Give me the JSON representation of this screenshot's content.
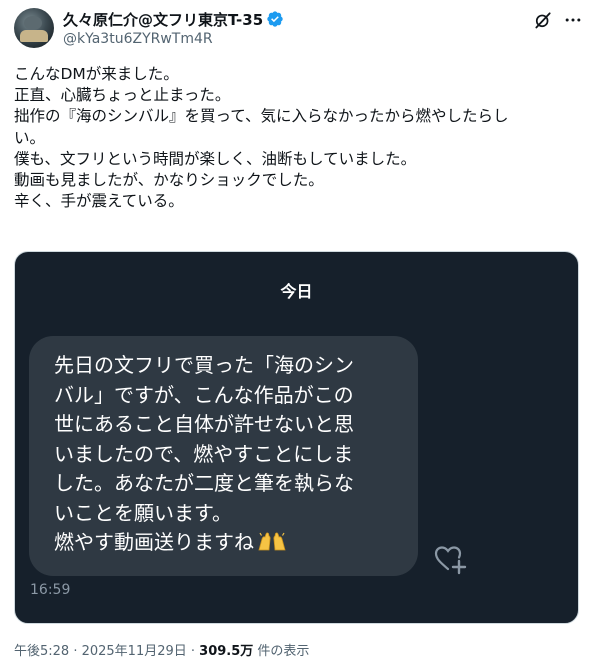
{
  "author": {
    "display_name": "久々原仁介@文フリ東京T-35",
    "handle": "@kYa3tu6ZYRwTm4R",
    "verified": true
  },
  "icons": {
    "verified": "verified-badge-icon",
    "grok": "grok-icon",
    "more": "more-options-icon",
    "react": "add-reaction-heart-icon",
    "emoji": "raising-hands-emoji"
  },
  "tweet": {
    "lines": [
      "こんなDMが来ました。",
      "正直、心臓ちょっと止まった。",
      "拙作の『海のシンバル』を買って、気に入らなかったから燃やしたらし",
      "い。",
      "僕も、文フリという時間が楽しく、油断もしていました。",
      "動画も見ましたが、かなりショックでした。",
      "辛く、手が震えている。"
    ]
  },
  "screenshot": {
    "day_label": "今日",
    "message_lines": [
      "先日の文フリで買った「海のシン",
      "バル」ですが、こんな作品がこの",
      "世にあること自体が許せないと思",
      "いましたので、燃やすことにしま",
      "した。あなたが二度と筆を執らな",
      "いことを願います。"
    ],
    "message_last_line": "燃やす動画送りますね",
    "message_time": "16:59"
  },
  "footer": {
    "timestamp": "午後5:28 · 2025年11月29日 · ",
    "views_count": "309.5万",
    "views_label": " 件の表示"
  },
  "colors": {
    "verified_blue": "#1d9bf0",
    "dm_background": "#16202b",
    "bubble_background": "#2f3943",
    "secondary_text": "#536471"
  }
}
